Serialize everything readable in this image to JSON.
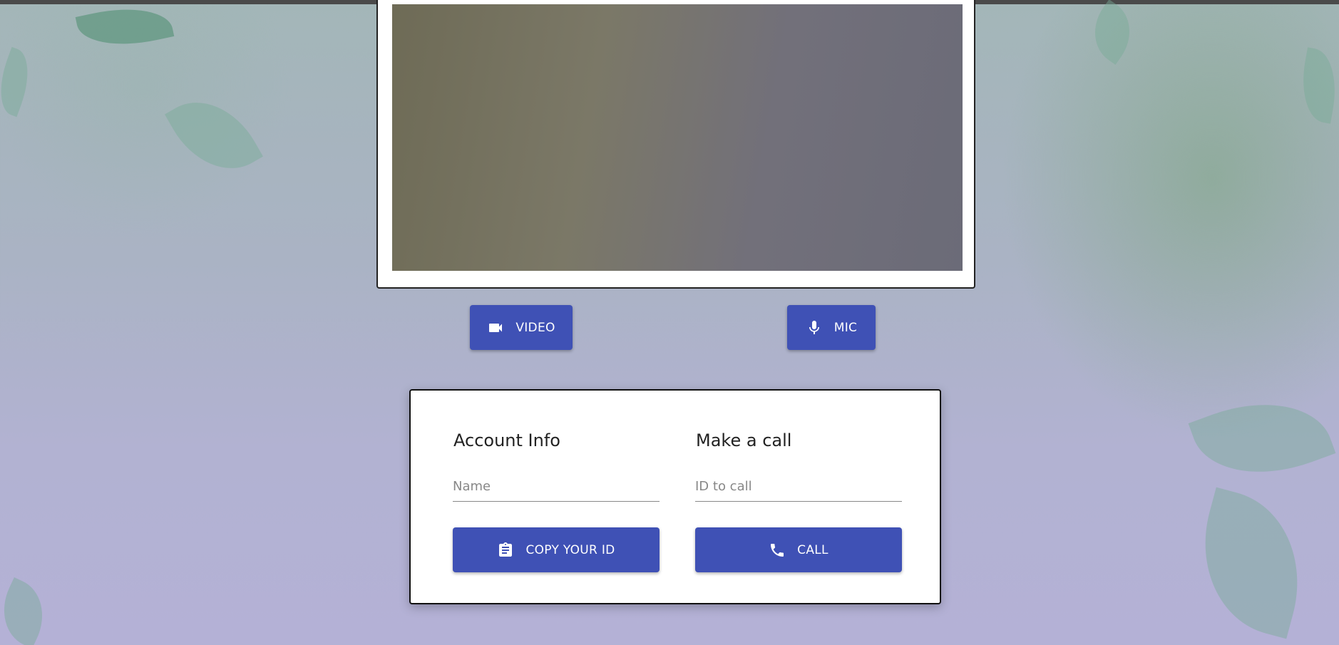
{
  "controls": {
    "video_label": "VIDEO",
    "mic_label": "MIC"
  },
  "account": {
    "title": "Account Info",
    "name_placeholder": "Name",
    "copy_label": "COPY YOUR ID"
  },
  "call": {
    "title": "Make a call",
    "id_placeholder": "ID to call",
    "call_label": "CALL"
  },
  "icons": {
    "video": "videocam-icon",
    "mic": "mic-icon",
    "copy": "clipboard-icon",
    "call": "phone-icon"
  },
  "colors": {
    "primary": "#3f51b5",
    "card": "#ffffff"
  }
}
